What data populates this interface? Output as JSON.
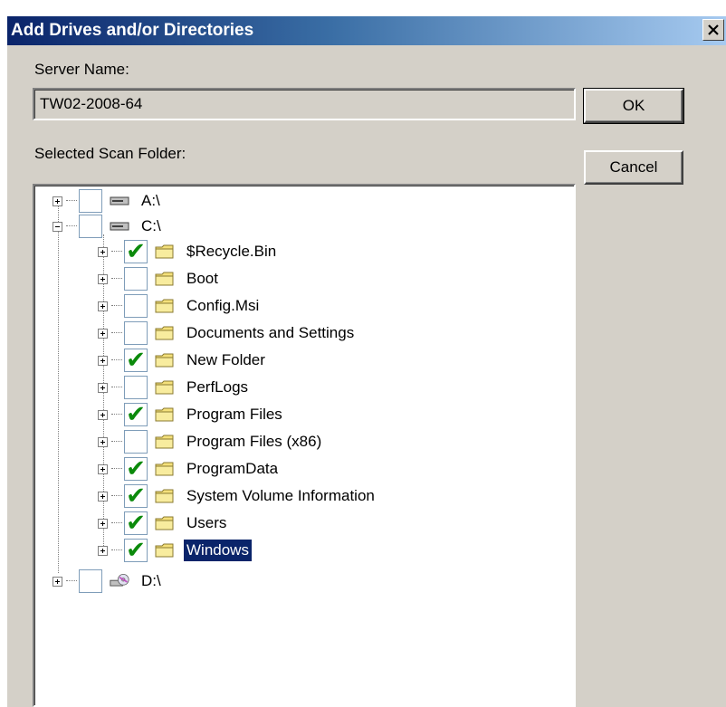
{
  "window": {
    "title": "Add Drives and/or Directories",
    "close_label": "X"
  },
  "server": {
    "label": "Server Name:",
    "value": "TW02-2008-64"
  },
  "folder": {
    "label": "Selected Scan Folder:"
  },
  "buttons": {
    "ok": "OK",
    "cancel": "Cancel"
  },
  "tree": {
    "drives": [
      {
        "label": "A:\\",
        "checked": false,
        "icon": "floppy-drive-icon",
        "expanded": false
      },
      {
        "label": "C:\\",
        "checked": false,
        "icon": "hard-drive-icon",
        "expanded": true
      },
      {
        "label": "D:\\",
        "checked": false,
        "icon": "cd-drive-icon",
        "expanded": false
      }
    ],
    "folders": [
      {
        "label": "$Recycle.Bin",
        "checked": true,
        "selected": false
      },
      {
        "label": "Boot",
        "checked": false,
        "selected": false
      },
      {
        "label": "Config.Msi",
        "checked": false,
        "selected": false
      },
      {
        "label": "Documents and Settings",
        "checked": false,
        "selected": false
      },
      {
        "label": "New Folder",
        "checked": true,
        "selected": false
      },
      {
        "label": "PerfLogs",
        "checked": false,
        "selected": false
      },
      {
        "label": "Program Files",
        "checked": true,
        "selected": false
      },
      {
        "label": "Program Files (x86)",
        "checked": false,
        "selected": false
      },
      {
        "label": "ProgramData",
        "checked": true,
        "selected": false
      },
      {
        "label": "System Volume Information",
        "checked": true,
        "selected": false
      },
      {
        "label": "Users",
        "checked": true,
        "selected": false
      },
      {
        "label": "Windows",
        "checked": true,
        "selected": true
      }
    ]
  },
  "colors": {
    "titlebar_start": "#0a246a",
    "titlebar_end": "#a6caf0",
    "dialog_bg": "#d4d0c8",
    "selection_bg": "#0a246a",
    "check_green": "#0b8a0b",
    "folder_yellow": "#f4e07a"
  }
}
